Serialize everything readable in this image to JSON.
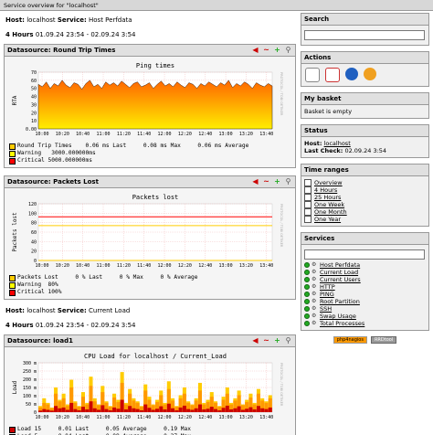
{
  "window": {
    "title": "Service overview for \"localhost\""
  },
  "host1": {
    "host_label": "Host:",
    "host": "localhost",
    "service_label": "Service:",
    "service": "Host Perfdata"
  },
  "host2": {
    "host_label": "Host:",
    "host": "localhost",
    "service_label": "Service:",
    "service": "Current Load"
  },
  "period": {
    "label": "4 Hours",
    "range": "01.09.24 23:54 - 02.09.24 3:54"
  },
  "period2": {
    "label": "4 Hours",
    "range": "01.09.24 23:54 - 02.09.24 3:54"
  },
  "ds1": {
    "title": "Datasource: Round Trip Times",
    "legend": [
      {
        "text": "Round Trip Times    0.06 ms Last     0.08 ms Max     0.06 ms Average",
        "color": "#ffcc00"
      },
      {
        "text": "Warning   3000.000000ms",
        "color": "#ffff00"
      },
      {
        "text": "Critical 5000.000000ms",
        "color": "#ff0000"
      }
    ]
  },
  "ds2": {
    "title": "Datasource: Packets Lost",
    "legend": [
      {
        "text": "Packets Lost     0 % Last     0 % Max     0 % Average",
        "color": "#ffcc00"
      },
      {
        "text": "Warning  80%",
        "color": "#ffff00"
      },
      {
        "text": "Critical 100%",
        "color": "#ff0000"
      }
    ]
  },
  "ds3": {
    "title": "Datasource: load1",
    "legend": [
      {
        "text": "Load 15     0.01 Last     0.05 Average     0.19 Max",
        "color": "#cc0000"
      },
      {
        "text": "Load 5      0.04 Last     0.08 Average     0.27 Max",
        "color": "#ff9900"
      },
      {
        "text": "Load 1      0.04 Last     0.08 Average     0.44 Max",
        "color": "#ffcc00"
      }
    ]
  },
  "chart_data": [
    {
      "type": "area",
      "title": "Ping times",
      "ylabel": "RTA",
      "x": [
        "10:00",
        "10:20",
        "10:40",
        "11:00",
        "11:20",
        "11:40",
        "12:00",
        "12:20",
        "12:40",
        "13:00",
        "13:20",
        "13:40"
      ],
      "yticks": [
        "0.00",
        "10",
        "20",
        "30",
        "40",
        "50",
        "60",
        "70"
      ],
      "ylim": [
        0,
        70
      ],
      "series": [
        {
          "name": "Round Trip Times",
          "values": [
            55,
            52,
            58,
            50,
            56,
            53,
            60,
            54,
            51,
            57,
            55,
            49,
            56,
            60,
            52,
            55,
            50,
            58,
            54,
            57,
            53,
            59,
            55,
            51,
            56,
            58,
            52,
            54,
            57,
            50,
            55,
            59,
            53,
            56,
            52,
            58,
            54,
            51,
            57,
            55,
            50,
            56,
            53,
            58,
            55,
            52,
            57,
            54,
            60,
            51,
            56,
            53,
            58,
            55,
            50,
            57,
            54,
            52,
            56,
            53
          ]
        }
      ],
      "side_text": "PROTOCOL / TOBI OETIKER"
    },
    {
      "type": "line",
      "title": "Packets lost",
      "ylabel": "Packets lost",
      "x": [
        "10:00",
        "10:20",
        "10:40",
        "11:00",
        "11:20",
        "11:40",
        "12:00",
        "12:20",
        "12:40",
        "13:00",
        "13:20",
        "13:40"
      ],
      "yticks": [
        "0",
        "20",
        "40",
        "60",
        "80",
        "100",
        "120"
      ],
      "ylim": [
        0,
        130
      ],
      "series": [
        {
          "name": "Packets Lost",
          "values": [
            0,
            0,
            0,
            0,
            0,
            0,
            0,
            0,
            0,
            0,
            0,
            0
          ]
        },
        {
          "name": "Warning",
          "values": [
            80,
            80,
            80,
            80,
            80,
            80,
            80,
            80,
            80,
            80,
            80,
            80
          ]
        },
        {
          "name": "Critical",
          "values": [
            100,
            100,
            100,
            100,
            100,
            100,
            100,
            100,
            100,
            100,
            100,
            100
          ]
        }
      ],
      "side_text": "PROTOCOL / TOBI OETIKER"
    },
    {
      "type": "bar",
      "title": "CPU Load for localhost / Current_Load",
      "ylabel": "Load",
      "x": [
        "10:00",
        "10:20",
        "10:40",
        "11:00",
        "11:20",
        "11:40",
        "12:00",
        "12:20",
        "12:40",
        "13:00",
        "13:20",
        "13:40"
      ],
      "yticks": [
        "0",
        "50 m",
        "100 m",
        "150 m",
        "200 m",
        "250 m",
        "300 m"
      ],
      "ylim": [
        0,
        320
      ],
      "series": [
        {
          "name": "Load 1",
          "values": [
            40,
            90,
            60,
            30,
            160,
            80,
            120,
            50,
            210,
            70,
            40,
            130,
            60,
            230,
            90,
            50,
            170,
            70,
            40,
            120,
            80,
            260,
            60,
            150,
            90,
            70,
            40,
            180,
            100,
            50,
            80,
            140,
            60,
            200,
            90,
            40,
            110,
            160,
            70,
            50,
            90,
            190,
            60,
            80,
            130,
            70,
            40,
            100,
            160,
            60,
            90,
            140,
            50,
            80,
            120,
            60,
            150,
            90,
            70,
            110
          ]
        },
        {
          "name": "Load 5",
          "values": [
            30,
            60,
            50,
            25,
            120,
            70,
            90,
            40,
            160,
            60,
            35,
            100,
            50,
            170,
            70,
            45,
            130,
            60,
            35,
            95,
            65,
            190,
            50,
            120,
            75,
            60,
            35,
            140,
            80,
            45,
            65,
            110,
            50,
            150,
            75,
            35,
            90,
            120,
            60,
            45,
            75,
            140,
            50,
            65,
            100,
            60,
            35,
            80,
            120,
            50,
            75,
            110,
            45,
            65,
            95,
            50,
            120,
            75,
            60,
            90
          ]
        },
        {
          "name": "Load 15",
          "values": [
            10,
            20,
            15,
            10,
            40,
            25,
            30,
            15,
            60,
            20,
            12,
            35,
            18,
            70,
            25,
            15,
            45,
            20,
            12,
            30,
            22,
            80,
            18,
            40,
            25,
            20,
            12,
            50,
            28,
            15,
            22,
            38,
            18,
            55,
            25,
            12,
            30,
            42,
            20,
            15,
            25,
            50,
            18,
            22,
            35,
            20,
            12,
            28,
            42,
            18,
            25,
            38,
            15,
            22,
            32,
            18,
            40,
            25,
            20,
            30
          ]
        }
      ],
      "side_text": "PROTOCOL / TOBI OETIKER"
    }
  ],
  "sidebar": {
    "search": {
      "title": "Search"
    },
    "actions": {
      "title": "Actions"
    },
    "basket": {
      "title": "My basket",
      "text": "Basket is empty"
    },
    "status": {
      "title": "Status",
      "host_label": "Host:",
      "host": "localhost",
      "check_label": "Last Check:",
      "check": "02.09.24 3:54"
    },
    "time_ranges": {
      "title": "Time ranges",
      "items": [
        "Overview",
        "4 Hours",
        "25 Hours",
        "One Week",
        "One Month",
        "One Year"
      ]
    },
    "services": {
      "title": "Services",
      "items": [
        "Host Perfdata",
        "Current Load",
        "Current Users",
        "HTTP",
        "PING",
        "Root Partition",
        "SSH",
        "Swap Usage",
        "Total Processes"
      ]
    },
    "badges": {
      "left": "php4nagios",
      "right": "RRDtool"
    }
  },
  "colors": {
    "accent": "#ff9900",
    "header_bg": "#e0e0e0",
    "ok": "#22aa22"
  }
}
